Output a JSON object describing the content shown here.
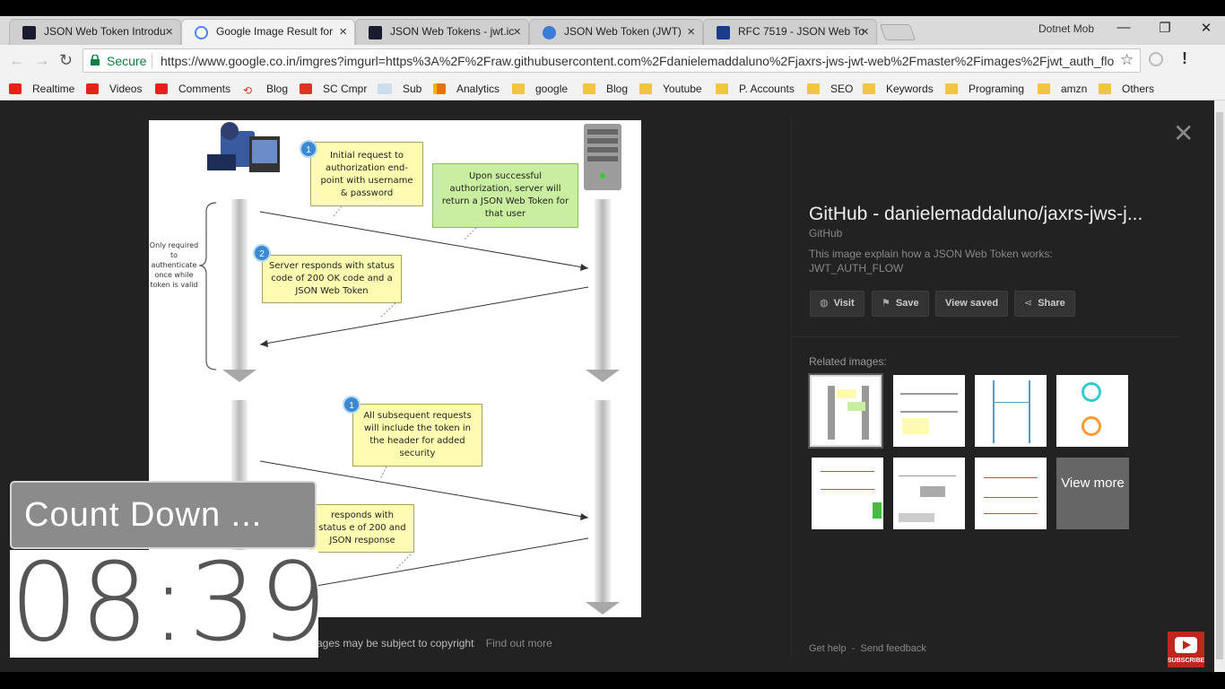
{
  "tabs": [
    {
      "label": "JSON Web Token Introdu",
      "favicon": "jwt-icon",
      "color": "#7b1fa2"
    },
    {
      "label": "Google Image Result for",
      "favicon": "google-icon",
      "color": "#4285f4"
    },
    {
      "label": "JSON Web Tokens - jwt.ic",
      "favicon": "jwt-icon",
      "color": "#7b1fa2"
    },
    {
      "label": "JSON Web Token (JWT)",
      "favicon": "globe-icon",
      "color": "#3a7bd5"
    },
    {
      "label": "RFC 7519 - JSON Web To",
      "favicon": "rfc-icon",
      "color": "#1a3c8a"
    }
  ],
  "profile_name": "Dotnet Mob",
  "address": {
    "secure_label": "Secure",
    "url": "https://www.google.co.in/imgres?imgurl=https%3A%2F%2Fraw.githubusercontent.com%2Fdanielemaddaluno%2Fjaxrs-jws-jwt-web%2Fmaster%2Fimages%2Fjwt_auth_flo..."
  },
  "bookmarks": [
    {
      "label": "Realtime",
      "icon": "yt"
    },
    {
      "label": "Videos",
      "icon": "yt"
    },
    {
      "label": "Comments",
      "icon": "yt"
    },
    {
      "label": "Blog",
      "icon": "sc"
    },
    {
      "label": "SC Cmpr",
      "icon": "sc"
    },
    {
      "label": "Sub",
      "icon": "lc"
    },
    {
      "label": "Analytics",
      "icon": "an"
    },
    {
      "label": "google",
      "icon": "folder"
    },
    {
      "label": "Blog",
      "icon": "folder"
    },
    {
      "label": "Youtube",
      "icon": "folder"
    },
    {
      "label": "P. Accounts",
      "icon": "folder"
    },
    {
      "label": "SEO",
      "icon": "folder"
    },
    {
      "label": "Keywords",
      "icon": "folder"
    },
    {
      "label": "Programing",
      "icon": "folder"
    },
    {
      "label": "amzn",
      "icon": "folder"
    },
    {
      "label": "Others",
      "icon": "folder"
    }
  ],
  "diagram": {
    "side_note": "Only required to authenticate once while token is valid",
    "step1": "Initial request to authorization end-point with username & password",
    "server_note": "Upon successful authorization, server will return a JSON Web Token for that user",
    "step2": "Server responds with status code of 200 OK code and a JSON Web Token",
    "step3": "All subsequent requests will include the token in the header for added security",
    "step4": "responds with status e of 200 and JSON response",
    "badge1": "1",
    "badge2": "2",
    "badge3": "1"
  },
  "copyright": "ages may be subject to copyright",
  "find_out_more": "Find out more",
  "panel": {
    "title": "GitHub - danielemaddaluno/jaxrs-jws-j...",
    "source": "GitHub",
    "description": "This image explain how a JSON Web Token works: JWT_AUTH_FLOW",
    "visit": "Visit",
    "save": "Save",
    "view_saved": "View saved",
    "share": "Share",
    "related_heading": "Related images:",
    "view_more": "View more",
    "get_help": "Get help",
    "send_feedback": "Send feedback"
  },
  "countdown": {
    "label": "Count Down ...",
    "time": "08:39"
  },
  "subscribe_label": "SUBSCRIBE"
}
